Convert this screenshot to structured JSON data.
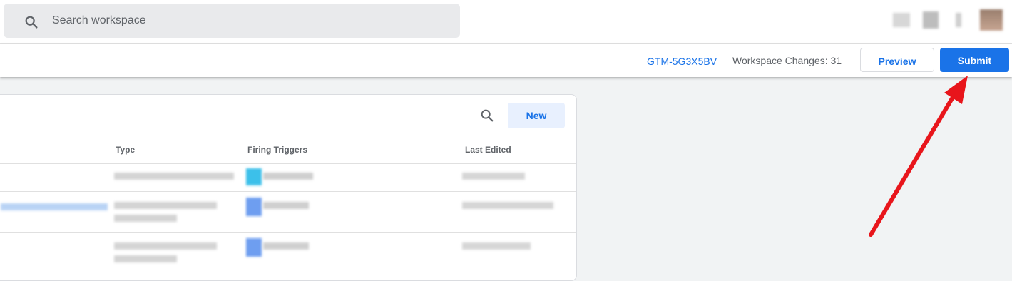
{
  "search": {
    "placeholder": "Search workspace"
  },
  "header": {
    "container_id": "GTM-5G3X5BV",
    "workspace_changes": "Workspace Changes: 31",
    "preview_label": "Preview",
    "submit_label": "Submit"
  },
  "tags_card": {
    "new_label": "New",
    "columns": [
      "Type",
      "Firing Triggers",
      "Last Edited"
    ],
    "rows": [
      {
        "name": "",
        "type": "",
        "trigger": "",
        "last_edited": ""
      },
      {
        "name": "",
        "type": "",
        "trigger": "",
        "last_edited": ""
      },
      {
        "name": "",
        "type": "",
        "trigger": "",
        "last_edited": ""
      }
    ]
  },
  "colors": {
    "accent": "#1a73e8",
    "annotation_arrow": "#e8151b",
    "background": "#f1f3f4"
  },
  "icons": [
    "search-icon",
    "search-icon"
  ],
  "annotation": {
    "type": "arrow",
    "points_to": "submit-button"
  }
}
